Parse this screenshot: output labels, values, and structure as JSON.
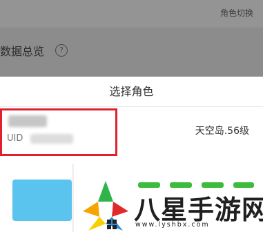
{
  "background": {
    "role_switch": "角色切换",
    "data_overview_title": "数据总览",
    "help_icon": "?"
  },
  "sheet": {
    "title": "选择角色",
    "role": {
      "uid_label": "UID",
      "server": "天空岛.56级"
    }
  },
  "watermark": {
    "brand_text": "八星手游网",
    "url": "www.lyshbx.com"
  },
  "colors": {
    "highlight": "#e0212d",
    "card_blue": "#5bc4ee",
    "overlay": "#8c8c8c"
  }
}
